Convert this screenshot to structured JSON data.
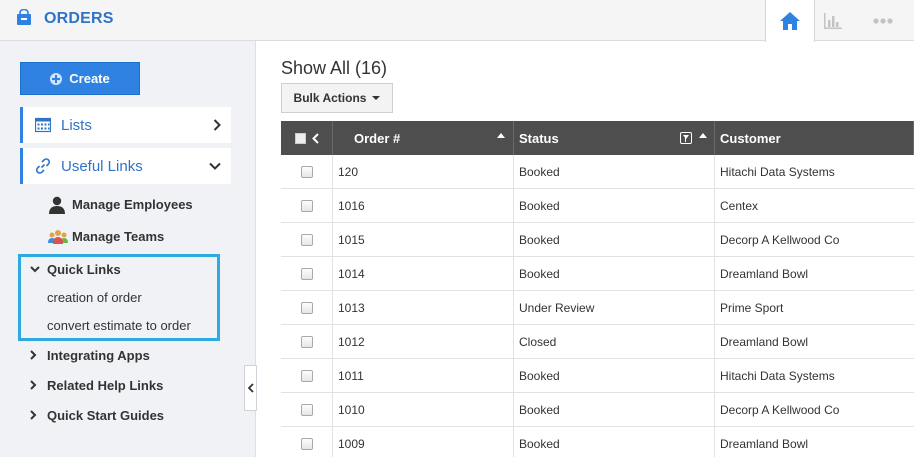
{
  "app": {
    "title": "ORDERS",
    "icon": "shopping-bag-icon",
    "accent_color": "#2f74c7"
  },
  "topbar": {
    "buttons": [
      {
        "name": "home",
        "icon": "home-icon",
        "active": true
      },
      {
        "name": "reports",
        "icon": "bar-chart-icon",
        "active": false
      },
      {
        "name": "more",
        "icon": "more-dots-icon",
        "active": false
      }
    ]
  },
  "sidebar": {
    "create_label": "Create",
    "lists_label": "Lists",
    "useful_links_label": "Useful Links",
    "useful_links": [
      {
        "label": "Manage Employees",
        "icon": "user-icon"
      },
      {
        "label": "Manage Teams",
        "icon": "team-icon"
      }
    ],
    "quick_links": {
      "label": "Quick Links",
      "items": [
        "creation of order",
        "convert estimate to order"
      ]
    },
    "groups": [
      "Integrating Apps",
      "Related Help Links",
      "Quick Start Guides"
    ],
    "highlight_color": "#2eaae1"
  },
  "main": {
    "title": "Show All (16)",
    "bulk_actions_label": "Bulk Actions",
    "columns": [
      "Order #",
      "Status",
      "Customer"
    ],
    "rows": [
      {
        "order": "120",
        "status": "Booked",
        "customer": "Hitachi Data Systems"
      },
      {
        "order": "1016",
        "status": "Booked",
        "customer": "Centex"
      },
      {
        "order": "1015",
        "status": "Booked",
        "customer": "Decorp A Kellwood Co"
      },
      {
        "order": "1014",
        "status": "Booked",
        "customer": "Dreamland Bowl"
      },
      {
        "order": "1013",
        "status": "Under Review",
        "customer": "Prime Sport"
      },
      {
        "order": "1012",
        "status": "Closed",
        "customer": "Dreamland Bowl"
      },
      {
        "order": "1011",
        "status": "Booked",
        "customer": "Hitachi Data Systems"
      },
      {
        "order": "1010",
        "status": "Booked",
        "customer": "Decorp A Kellwood Co"
      },
      {
        "order": "1009",
        "status": "Booked",
        "customer": "Dreamland Bowl"
      }
    ]
  }
}
